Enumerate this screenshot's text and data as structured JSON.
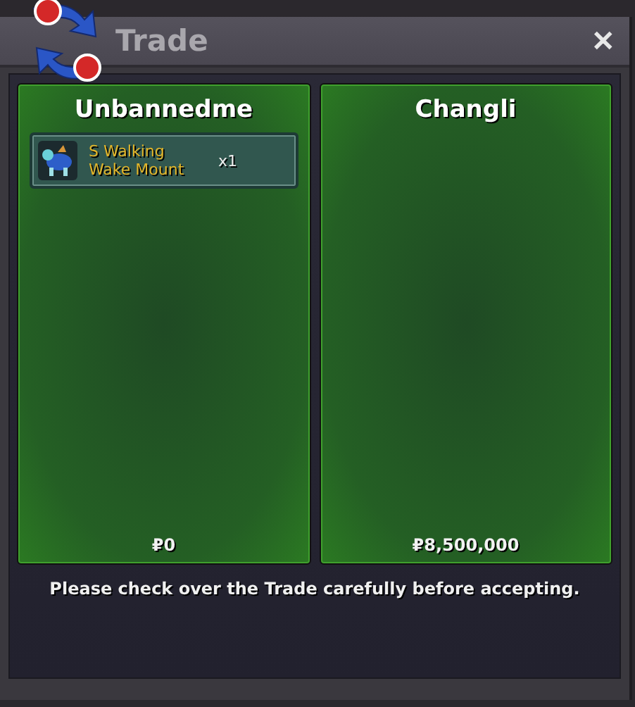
{
  "window": {
    "title": "Trade",
    "close": "✕"
  },
  "sides": [
    {
      "player": "Unbannedme",
      "items": [
        {
          "name": "S Walking\nWake Mount",
          "quantity": "x1"
        }
      ],
      "money": "₽0"
    },
    {
      "player": "Changli",
      "money": "₽8,500,000"
    }
  ],
  "notice": "Please check over the Trade carefully before accepting."
}
